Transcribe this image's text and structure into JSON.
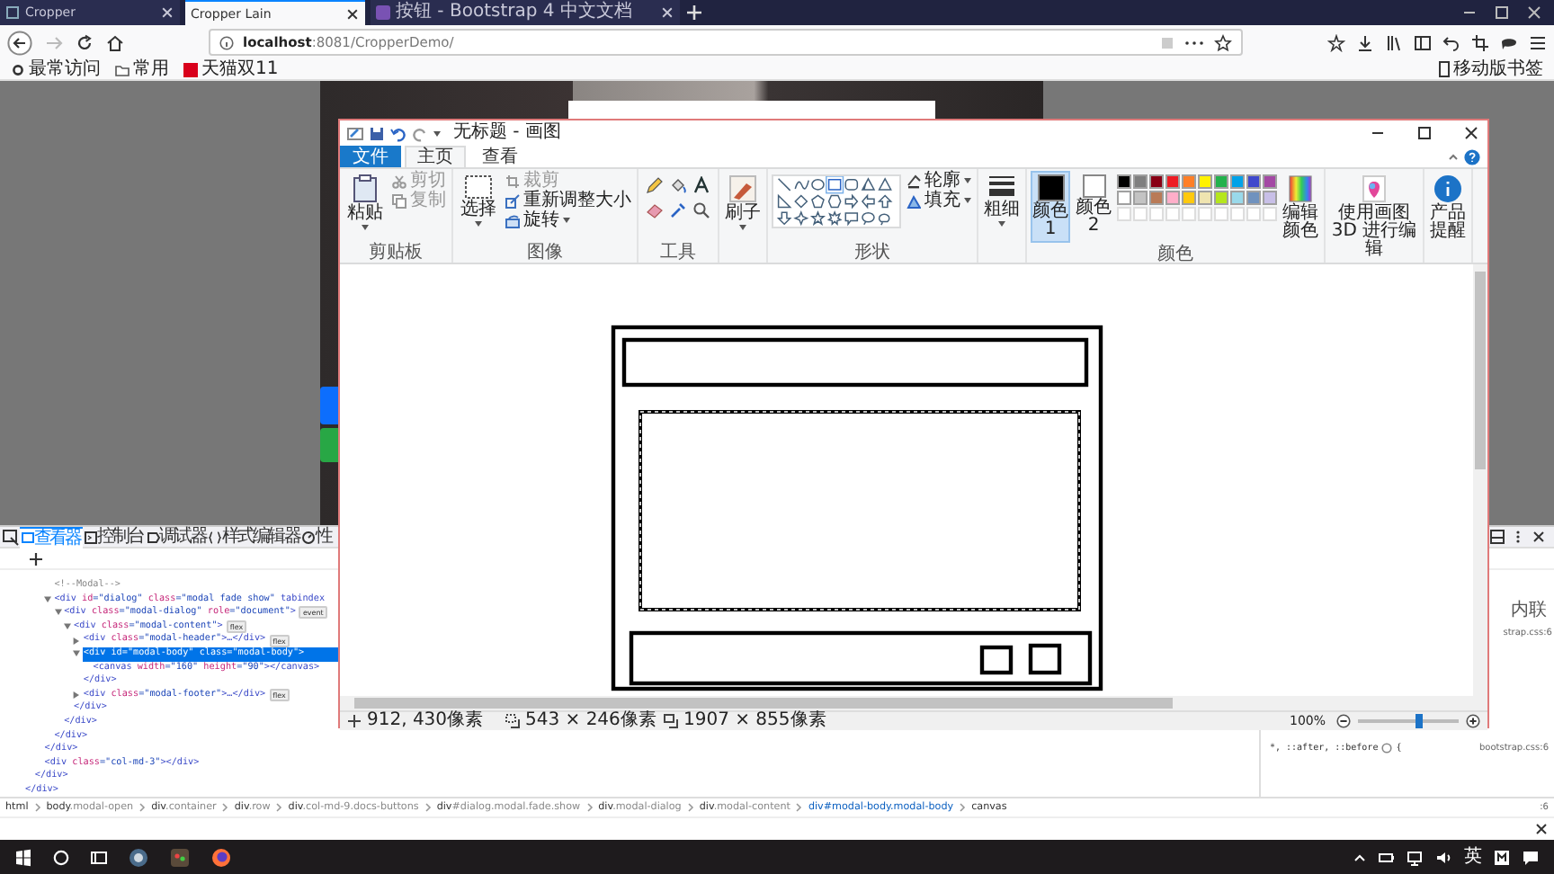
{
  "browser": {
    "tabs": [
      {
        "label": "Cropper",
        "kind": "page",
        "selected": false
      },
      {
        "label": "Cropper Lain",
        "kind": "plain",
        "selected": true
      },
      {
        "label": "按钮 - Bootstrap 4 中文文档",
        "kind": "logo",
        "selected": false
      }
    ],
    "url": {
      "host": "localhost",
      "rest": ":8081/CropperDemo/"
    },
    "bookmarks": [
      {
        "kind": "gear",
        "label": "最常访问"
      },
      {
        "kind": "folder",
        "label": "常用"
      },
      {
        "kind": "logo",
        "label": "天猫双11"
      }
    ],
    "mobile_bookmarks": "移动版书签"
  },
  "paint": {
    "title": "无标题 - 画图",
    "tabs": [
      {
        "label": "文件",
        "kind": "file",
        "selected": false
      },
      {
        "label": "主页",
        "kind": "tab",
        "selected": true
      },
      {
        "label": "查看",
        "kind": "tab",
        "selected": false
      }
    ],
    "groups": [
      {
        "kind": "clipboard",
        "label": "剪贴板",
        "button": "粘贴",
        "items": [
          {
            "label": "剪切",
            "disabled": true
          },
          {
            "label": "复制",
            "disabled": true
          }
        ]
      },
      {
        "kind": "image",
        "label": "图像",
        "button": "选择",
        "items": [
          {
            "label": "裁剪",
            "disabled": true
          },
          {
            "label": "重新调整大小",
            "disabled": false
          },
          {
            "label": "旋转",
            "disabled": false
          }
        ]
      },
      {
        "kind": "tools",
        "label": "工具"
      },
      {
        "kind": "brushes",
        "button": "刷子"
      },
      {
        "kind": "shapes",
        "label": "形状",
        "items": [
          {
            "label": "轮廓",
            "disabled": false
          },
          {
            "label": "填充",
            "disabled": false
          }
        ]
      },
      {
        "kind": "size",
        "button": "粗细"
      },
      {
        "kind": "colors",
        "label": "颜色",
        "slots": [
          {
            "label": "颜色 1",
            "color": "#000000",
            "selected": true
          },
          {
            "label": "颜色 2",
            "color": "#ffffff",
            "selected": false
          }
        ],
        "palette": [
          {
            "kind": "swatch",
            "color": "#000000"
          },
          {
            "kind": "swatch",
            "color": "#7f7f7f"
          },
          {
            "kind": "swatch",
            "color": "#880015"
          },
          {
            "kind": "swatch",
            "color": "#ed1c24"
          },
          {
            "kind": "swatch",
            "color": "#ff7f27"
          },
          {
            "kind": "swatch",
            "color": "#fff200"
          },
          {
            "kind": "swatch",
            "color": "#22b14c"
          },
          {
            "kind": "swatch",
            "color": "#00a2e8"
          },
          {
            "kind": "swatch",
            "color": "#3f48cc"
          },
          {
            "kind": "swatch",
            "color": "#a349a4"
          },
          {
            "kind": "swatch",
            "color": "#ffffff"
          },
          {
            "kind": "swatch",
            "color": "#c3c3c3"
          },
          {
            "kind": "swatch",
            "color": "#b97a57"
          },
          {
            "kind": "swatch",
            "color": "#ffaec9"
          },
          {
            "kind": "swatch",
            "color": "#ffc90e"
          },
          {
            "kind": "swatch",
            "color": "#efe4b0"
          },
          {
            "kind": "swatch",
            "color": "#b5e61d"
          },
          {
            "kind": "swatch",
            "color": "#99d9ea"
          },
          {
            "kind": "swatch",
            "color": "#7092be"
          },
          {
            "kind": "swatch",
            "color": "#c8bfe7"
          },
          {
            "kind": "empty"
          },
          {
            "kind": "empty"
          },
          {
            "kind": "empty"
          },
          {
            "kind": "empty"
          },
          {
            "kind": "empty"
          },
          {
            "kind": "empty"
          },
          {
            "kind": "empty"
          },
          {
            "kind": "empty"
          },
          {
            "kind": "empty"
          },
          {
            "kind": "empty"
          }
        ],
        "edit": "编辑颜色"
      },
      {
        "kind": "paint3d",
        "button": "使用画图 3D 进行编辑"
      },
      {
        "kind": "alert",
        "button": "产品提醒"
      }
    ],
    "status": {
      "cursor": "912, 430像素",
      "selection": "543 × 246像素",
      "size": "1907 × 855像素",
      "zoom": {
        "reading": "100%",
        "level": 0.6
      }
    }
  },
  "devtools": {
    "tabs": [
      {
        "label": "查看器",
        "kind": "inspector",
        "selected": true
      },
      {
        "label": "控制台",
        "kind": "console",
        "selected": false
      },
      {
        "label": "调试器",
        "kind": "debugger",
        "selected": false
      },
      {
        "label": "样式编辑器",
        "kind": "style",
        "selected": false
      },
      {
        "label": "性",
        "kind": "performance",
        "selected": false
      }
    ],
    "tree": [
      {
        "closing": "</div>",
        "children": [
          {
            "closing": "</div>",
            "children": [
              {
                "closing": "</div>",
                "children": [
                  {
                    "kind": "comment",
                    "text": "<!--Modal-->"
                  },
                  {
                    "kind": "element",
                    "text": "<div id=\"dialog\" class=\"modal fade show\" tabindex",
                    "expanded": true,
                    "selected": false,
                    "closing": "</div>",
                    "children": [
                      {
                        "kind": "element",
                        "text": "<div class=\"modal-dialog\" role=\"document\">",
                        "badge": "event",
                        "expanded": true,
                        "selected": false,
                        "closing": "</div>",
                        "children": [
                          {
                            "kind": "element",
                            "text": "<div class=\"modal-content\">",
                            "badge": "flex",
                            "expanded": true,
                            "selected": false,
                            "closing": "</div>",
                            "children": [
                              {
                                "kind": "element",
                                "text": "<div class=\"modal-header\">…</div>",
                                "badge": "flex",
                                "expanded": false,
                                "selected": false
                              },
                              {
                                "kind": "element",
                                "text": "<div id=\"modal-body\" class=\"modal-body\">",
                                "expanded": true,
                                "selected": true,
                                "closing": "</div>",
                                "children": [
                                  {
                                    "kind": "leaf",
                                    "text": "<canvas width=\"160\" height=\"90\"></canvas>"
                                  }
                                ]
                              },
                              {
                                "kind": "element",
                                "text": "<div class=\"modal-footer\">…</div>",
                                "badge": "flex",
                                "expanded": false,
                                "selected": false
                              }
                            ]
                          }
                        ]
                      }
                    ]
                  }
                ]
              },
              {
                "kind": "leaf",
                "text": "<div class=\"col-md-3\"></div>"
              }
            ]
          }
        ]
      }
    ],
    "rules": {
      "inline": "内联",
      "source": "strap.css:6",
      "selector": "*, ::after, ::before",
      "brace": "{",
      "selector_source": "bootstrap.css:6",
      "line_ref": ":6"
    },
    "breadcrumb": [
      {
        "label": "html",
        "selected": false
      },
      {
        "label": "body.modal-open",
        "selected": false
      },
      {
        "label": "div.container",
        "selected": false
      },
      {
        "label": "div.row",
        "selected": false
      },
      {
        "label": "div.col-md-9.docs-buttons",
        "selected": false
      },
      {
        "label": "div#dialog.modal.fade.show",
        "selected": false
      },
      {
        "label": "div.modal-dialog",
        "selected": false
      },
      {
        "label": "div.modal-content",
        "selected": false
      },
      {
        "label": "div#modal-body.modal-body",
        "selected": true
      },
      {
        "label": "canvas",
        "selected": false
      }
    ]
  },
  "taskbar": {
    "ime": "英"
  }
}
